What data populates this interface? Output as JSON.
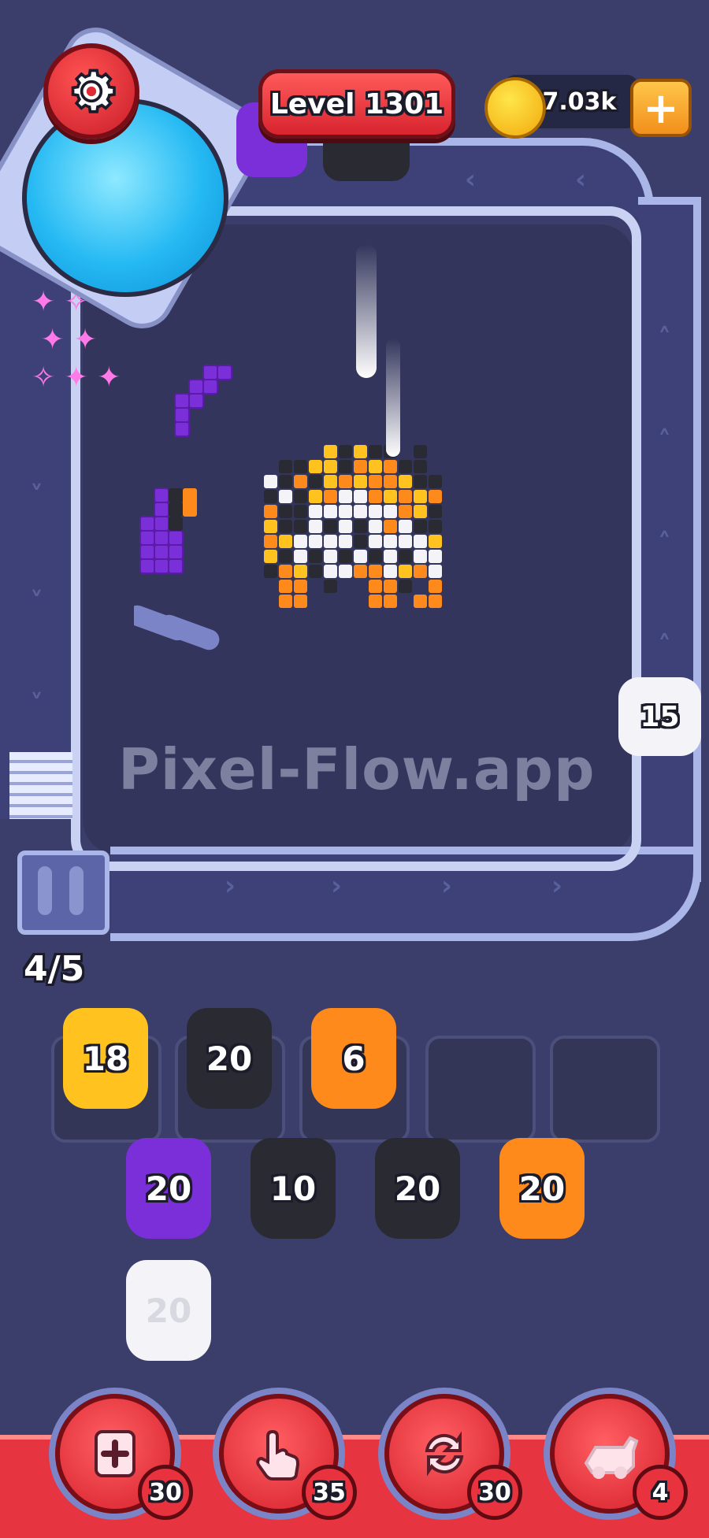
{
  "header": {
    "level_label": "Level 1301",
    "coins": "17.03k",
    "settings_icon": "gear-icon",
    "add_coins_icon": "plus-icon"
  },
  "watermark": "Pixel-Flow.app",
  "progress": {
    "label": "4/5",
    "value": 4,
    "max": 5
  },
  "track_piece": {
    "count": "15",
    "color": "#f4f4f8"
  },
  "dock_slots": [
    {
      "count": "18",
      "color": "#ffc21e",
      "filled": true
    },
    {
      "count": "20",
      "color": "#2a2a32",
      "filled": true
    },
    {
      "count": "6",
      "color": "#ff8a1c",
      "filled": true
    },
    {
      "count": "",
      "filled": false
    },
    {
      "count": "",
      "filled": false
    }
  ],
  "queue_row1": [
    {
      "count": "20",
      "color": "#7a2fd8"
    },
    {
      "count": "10",
      "color": "#2a2a32"
    },
    {
      "count": "20",
      "color": "#2a2a32"
    },
    {
      "count": "20",
      "color": "#ff8a1c"
    }
  ],
  "queue_row2": [
    {
      "count": "20",
      "color": "#f4f4f8"
    }
  ],
  "tools": [
    {
      "name": "add-slot",
      "icon": "add-slot-icon",
      "count": "30"
    },
    {
      "name": "tap",
      "icon": "hand-pointer-icon",
      "count": "35"
    },
    {
      "name": "shuffle",
      "icon": "shuffle-icon",
      "count": "30"
    },
    {
      "name": "train",
      "icon": "train-icon",
      "count": "4"
    }
  ],
  "colors": {
    "background": "#3b3e6a",
    "board": "#33355c",
    "track_rail": "#aab6e8",
    "accent_red": "#e63540",
    "purple": "#7a2fd8",
    "black": "#2a2a32",
    "orange": "#ff8a1c",
    "yellow": "#ffc21e",
    "white": "#f4f4f8"
  }
}
